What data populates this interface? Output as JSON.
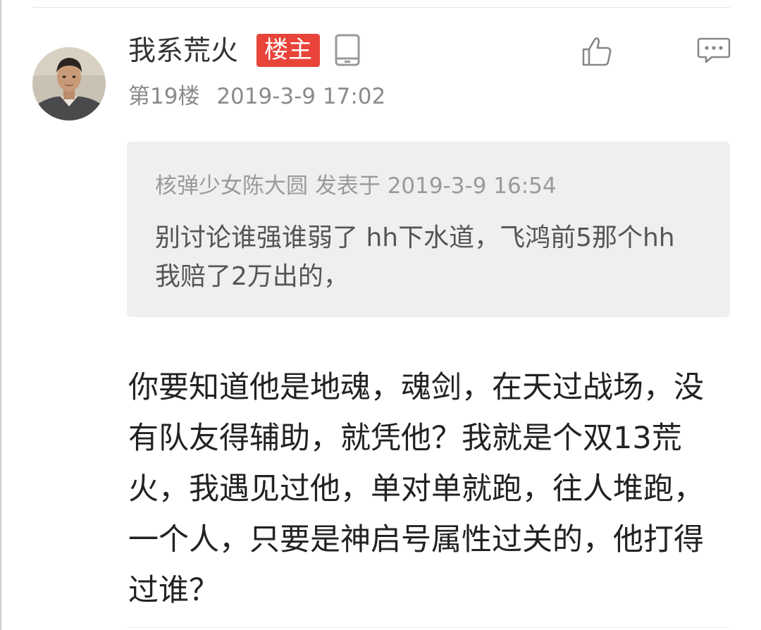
{
  "post": {
    "username": "我系荒火",
    "op_badge": "楼主",
    "device_icon": "phone-icon",
    "floor": "第19楼",
    "timestamp": "2019-3-9 17:02",
    "actions": {
      "like_icon": "thumbs-up-icon",
      "reply_icon": "comment-bubble-icon"
    },
    "quote": {
      "author_line": "核弹少女陈大圆 发表于 2019-3-9 16:54",
      "text": "别讨论谁强谁弱了 hh下水道，飞鸿前5那个hh我赔了2万出的，"
    },
    "body": "你要知道他是地魂，魂剑，在天过战场，没有队友得辅助，就凭他？我就是个双13荒火，我遇见过他，单对单就跑，往人堆跑，一个人，只要是神启号属性过关的，他打得过谁？"
  },
  "colors": {
    "badge_bg": "#e8443a",
    "quote_bg": "#efefef",
    "meta_text": "#8a8a8a",
    "icon_gray": "#888888"
  }
}
